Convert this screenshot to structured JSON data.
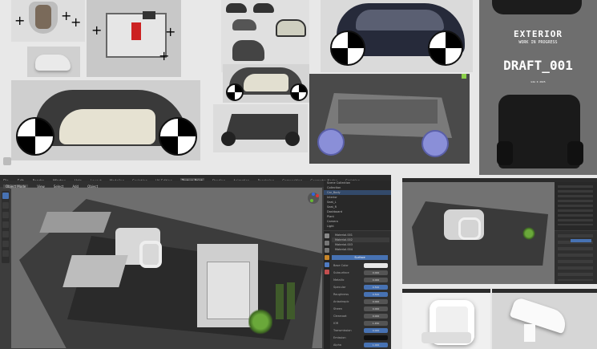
{
  "board": {
    "exterior_title": "EXTERIOR",
    "wip_label": "WORK IN PROGRESS",
    "draft_label": "DRAFT_001",
    "small_credit": "GIA K 2025"
  },
  "blender": {
    "menu": [
      "File",
      "Edit",
      "Render",
      "Window",
      "Help"
    ],
    "workspaces": [
      "Layout",
      "Modeling",
      "Sculpting",
      "UV Editing",
      "Texture Paint",
      "Shading",
      "Animation",
      "Rendering",
      "Compositing",
      "Geometry Nodes",
      "Scripting"
    ],
    "active_workspace": "Texture Paint",
    "mode_label": "Object Mode",
    "header_items": [
      "View",
      "Select",
      "Add",
      "Object"
    ],
    "outliner_rows": [
      "Scene Collection",
      "Collection",
      "Car_Body",
      "Interior",
      "Seat_L",
      "Seat_R",
      "Dashboard",
      "Plant",
      "Camera",
      "Light"
    ],
    "properties": {
      "section_surface": "Surface",
      "material_slots": [
        "Material.001",
        "Material.002",
        "Material.003",
        "Material.004"
      ],
      "rows": [
        {
          "label": "Base Color",
          "value": ""
        },
        {
          "label": "Subsurface",
          "value": "0.000"
        },
        {
          "label": "Metallic",
          "value": "0.000"
        },
        {
          "label": "Specular",
          "value": "0.500"
        },
        {
          "label": "Roughness",
          "value": "0.500"
        },
        {
          "label": "Anisotropic",
          "value": "0.000"
        },
        {
          "label": "Sheen",
          "value": "0.000"
        },
        {
          "label": "Clearcoat",
          "value": "0.000"
        },
        {
          "label": "IOR",
          "value": "1.450"
        },
        {
          "label": "Transmission",
          "value": "0.000"
        },
        {
          "label": "Emission",
          "value": ""
        },
        {
          "label": "Alpha",
          "value": "1.000"
        }
      ]
    }
  }
}
